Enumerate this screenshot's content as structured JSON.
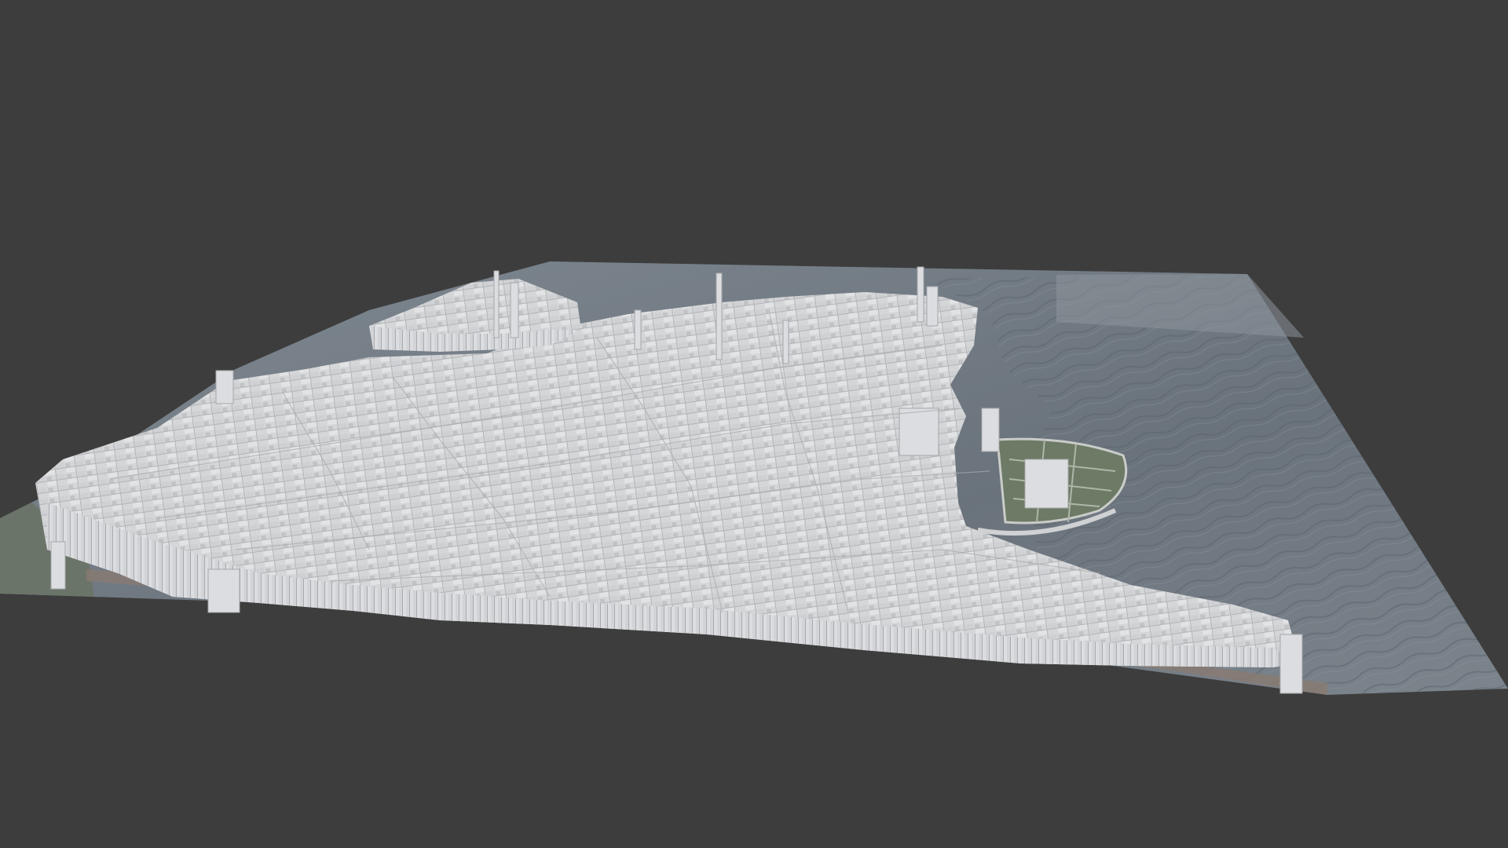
{
  "viewport": {
    "background_color": "#3d3d3d"
  },
  "scene": {
    "ground_plane_color": "#9aa1a8",
    "water_color": "#6e7780",
    "water_dark_color": "#4c5560",
    "building_color": "#d9d9db",
    "building_shadow_color": "#b9babd",
    "building_side_color": "#c8c9cc",
    "imagery_colors": [
      "#5c6e5a",
      "#7c7f7a",
      "#8a6f66",
      "#6a7686"
    ]
  }
}
